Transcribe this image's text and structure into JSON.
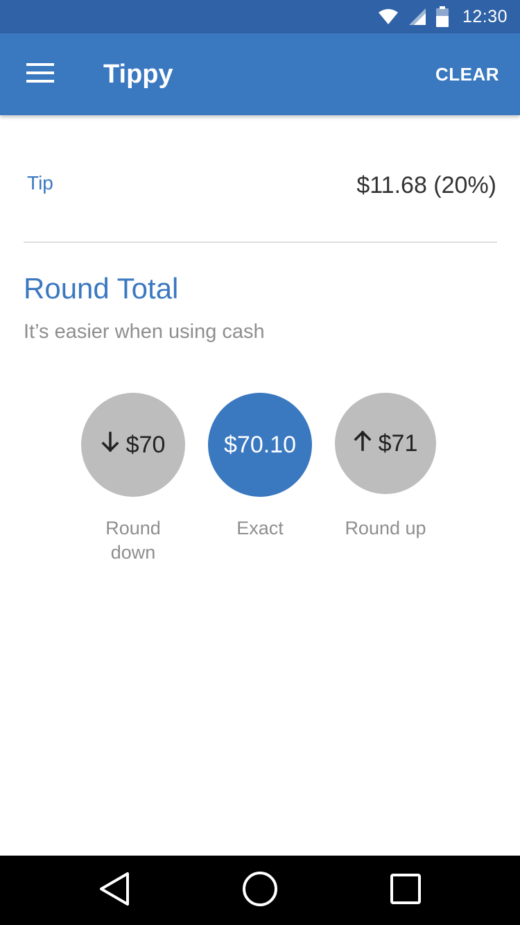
{
  "status_bar": {
    "time": "12:30",
    "icons": [
      "wifi-icon",
      "signal-icon",
      "battery-icon"
    ]
  },
  "app_bar": {
    "menu_icon": "hamburger-menu-icon",
    "title": "Tippy",
    "clear_label": "CLEAR"
  },
  "tip": {
    "label": "Tip",
    "value": "$11.68 (20%)"
  },
  "round_total": {
    "title": "Round Total",
    "subtitle": "It’s easier when using cash",
    "options": [
      {
        "amount": "$70",
        "label": "Round down",
        "icon": "arrow-down-icon",
        "selected": false
      },
      {
        "amount": "$70.10",
        "label": "Exact",
        "icon": "",
        "selected": true
      },
      {
        "amount": "$71",
        "label": "Round up",
        "icon": "arrow-up-icon",
        "selected": false
      }
    ]
  },
  "nav_bar": {
    "buttons": [
      "back-icon",
      "home-icon",
      "recents-icon"
    ]
  },
  "colors": {
    "primary": "#3a78c0",
    "status_bar": "#2f62a6",
    "unselected": "#bdbdbd",
    "secondary_text": "#8e8e8e"
  }
}
